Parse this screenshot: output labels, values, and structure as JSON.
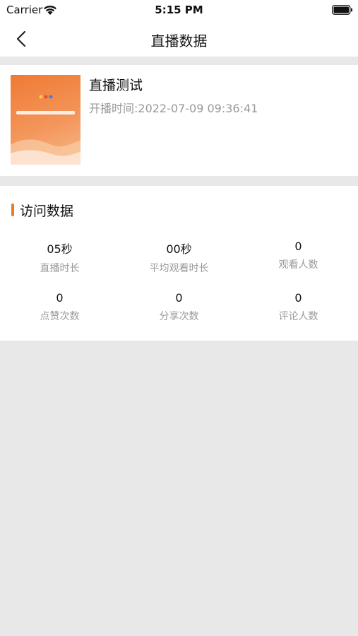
{
  "status_bar": {
    "carrier": "Carrier",
    "time": "5:15 PM"
  },
  "nav": {
    "title": "直播数据"
  },
  "live": {
    "title": "直播测试",
    "start_time": "开播时间:2022-07-09 09:36:41"
  },
  "stats": {
    "section_title": "访问数据",
    "items": [
      {
        "value": "05秒",
        "label": "直播时长"
      },
      {
        "value": "00秒",
        "label": "平均观看时长"
      },
      {
        "value": "0",
        "label": "观看人数"
      },
      {
        "value": "0",
        "label": "点赞次数"
      },
      {
        "value": "0",
        "label": "分享次数"
      },
      {
        "value": "0",
        "label": "评论人数"
      }
    ]
  },
  "colors": {
    "accent": "#f07a22",
    "page_bg": "#e8e8e8",
    "muted_text": "#999999"
  }
}
